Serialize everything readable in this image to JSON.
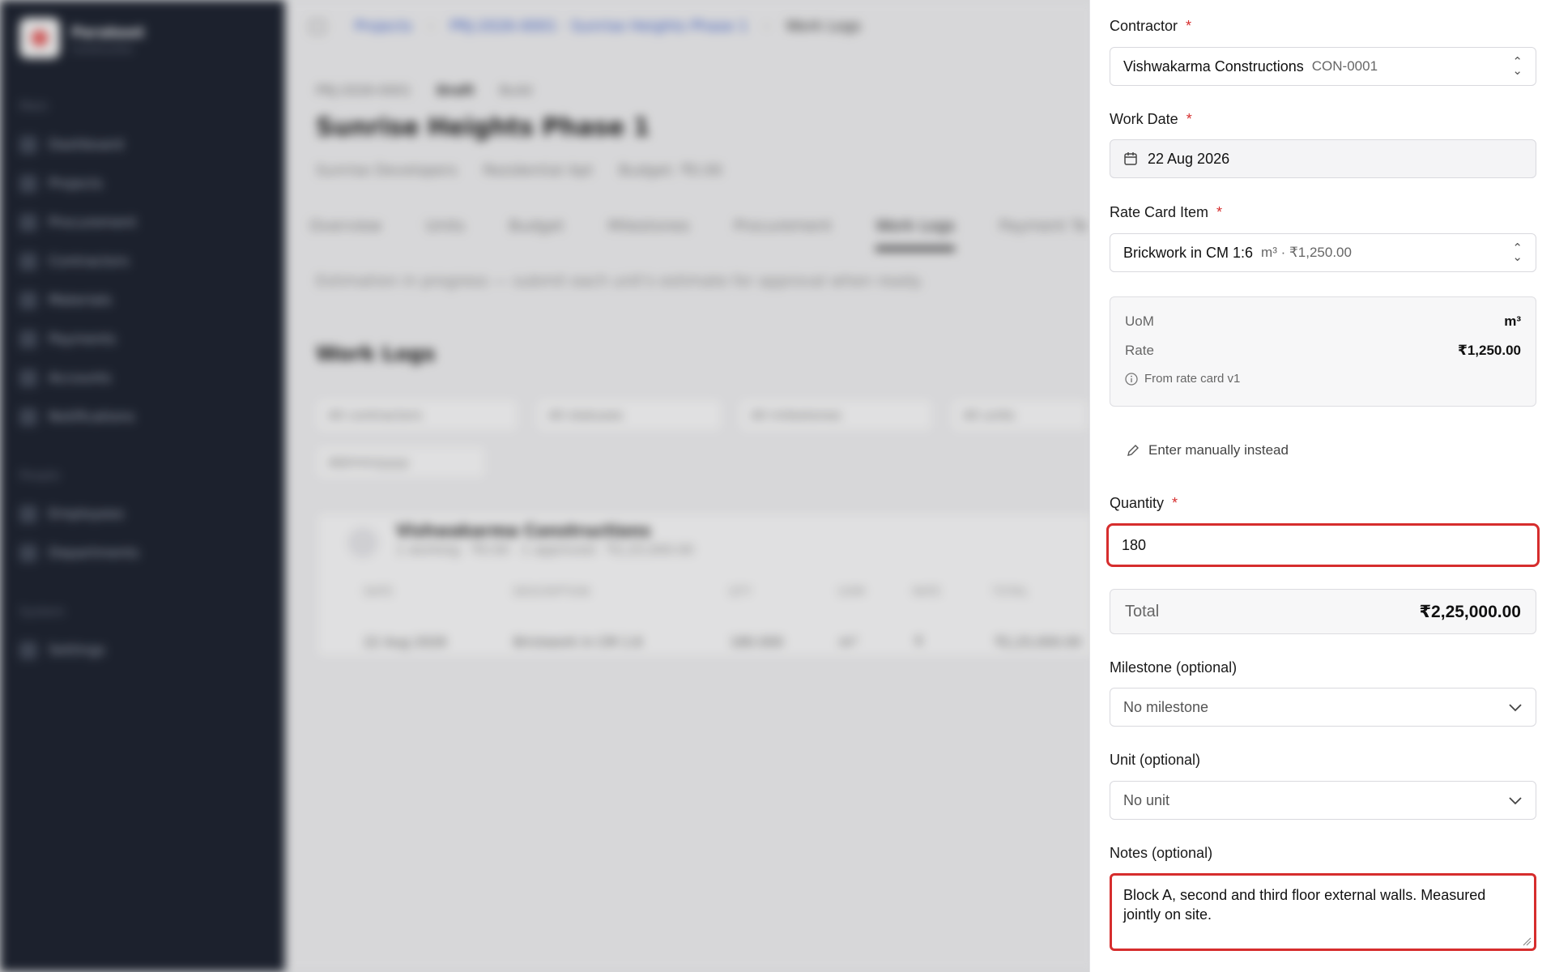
{
  "background": {
    "brand": {
      "name": "Parakeet",
      "tagline": "Construction"
    },
    "nav_sections": [
      "Main",
      "People",
      "System"
    ],
    "nav_items": [
      "Dashboard",
      "Projects",
      "Procurement",
      "Contractors",
      "Materials",
      "Payments",
      "Accounts",
      "Notifications",
      "Employees",
      "Departments",
      "Settings"
    ],
    "breadcrumb": {
      "root": "Projects",
      "project": "PRJ-2026-0001 · Sunrise Heights Phase 1",
      "current": "Work Logs"
    },
    "project": {
      "code": "PRJ-2026-0001",
      "status": "Draft",
      "badge": "Build",
      "title": "Sunrise Heights Phase 1",
      "client": "Sunrise Developers",
      "type": "Residential Apt",
      "budget": "Budget: ₹0.00"
    },
    "tabs": [
      "Overview",
      "Units",
      "Budget",
      "Milestones",
      "Procurement",
      "Work Logs",
      "Payment Te"
    ],
    "hint": "Estimation in progress — submit each unit's estimate for approval when ready.",
    "worklogs_title": "Work Logs",
    "filters": [
      "All contractors",
      "All statuses",
      "All milestones",
      "All units",
      "dd/mm/yyyy"
    ],
    "group": {
      "name": "Vishwakarma Constructions",
      "meta": "1 worklog · ₹0.00 · 1 approved · ₹2,25,000.00"
    },
    "table_headers": [
      "DATE",
      "DESCRIPTION",
      "QTY",
      "UOM",
      "RATE",
      "TOTAL"
    ],
    "table_row": [
      "22 Aug 2026",
      "Brickwork in CM 1:6",
      "180.000",
      "m³",
      "₹",
      "₹2,25,000.00"
    ]
  },
  "form": {
    "contractor": {
      "label": "Contractor",
      "value": "Vishwakarma Constructions",
      "code": "CON-0001"
    },
    "work_date": {
      "label": "Work Date",
      "value": "22 Aug 2026"
    },
    "rate_card": {
      "label": "Rate Card Item",
      "value": "Brickwork in CM 1:6",
      "detail": "m³ · ₹1,250.00"
    },
    "info": {
      "uom_label": "UoM",
      "uom_value": "m³",
      "rate_label": "Rate",
      "rate_value": "₹1,250.00",
      "source": "From rate card v1"
    },
    "manual_link": "Enter manually instead",
    "quantity": {
      "label": "Quantity",
      "value": "180"
    },
    "total": {
      "label": "Total",
      "value": "₹2,25,000.00"
    },
    "milestone": {
      "label": "Milestone (optional)",
      "value": "No milestone"
    },
    "unit": {
      "label": "Unit (optional)",
      "value": "No unit"
    },
    "notes": {
      "label": "Notes (optional)",
      "value": "Block A, second and third floor external walls. Measured jointly on site."
    },
    "required_mark": "*",
    "colors": {
      "error_border": "#d62d2d",
      "required": "#d62d2d"
    }
  }
}
